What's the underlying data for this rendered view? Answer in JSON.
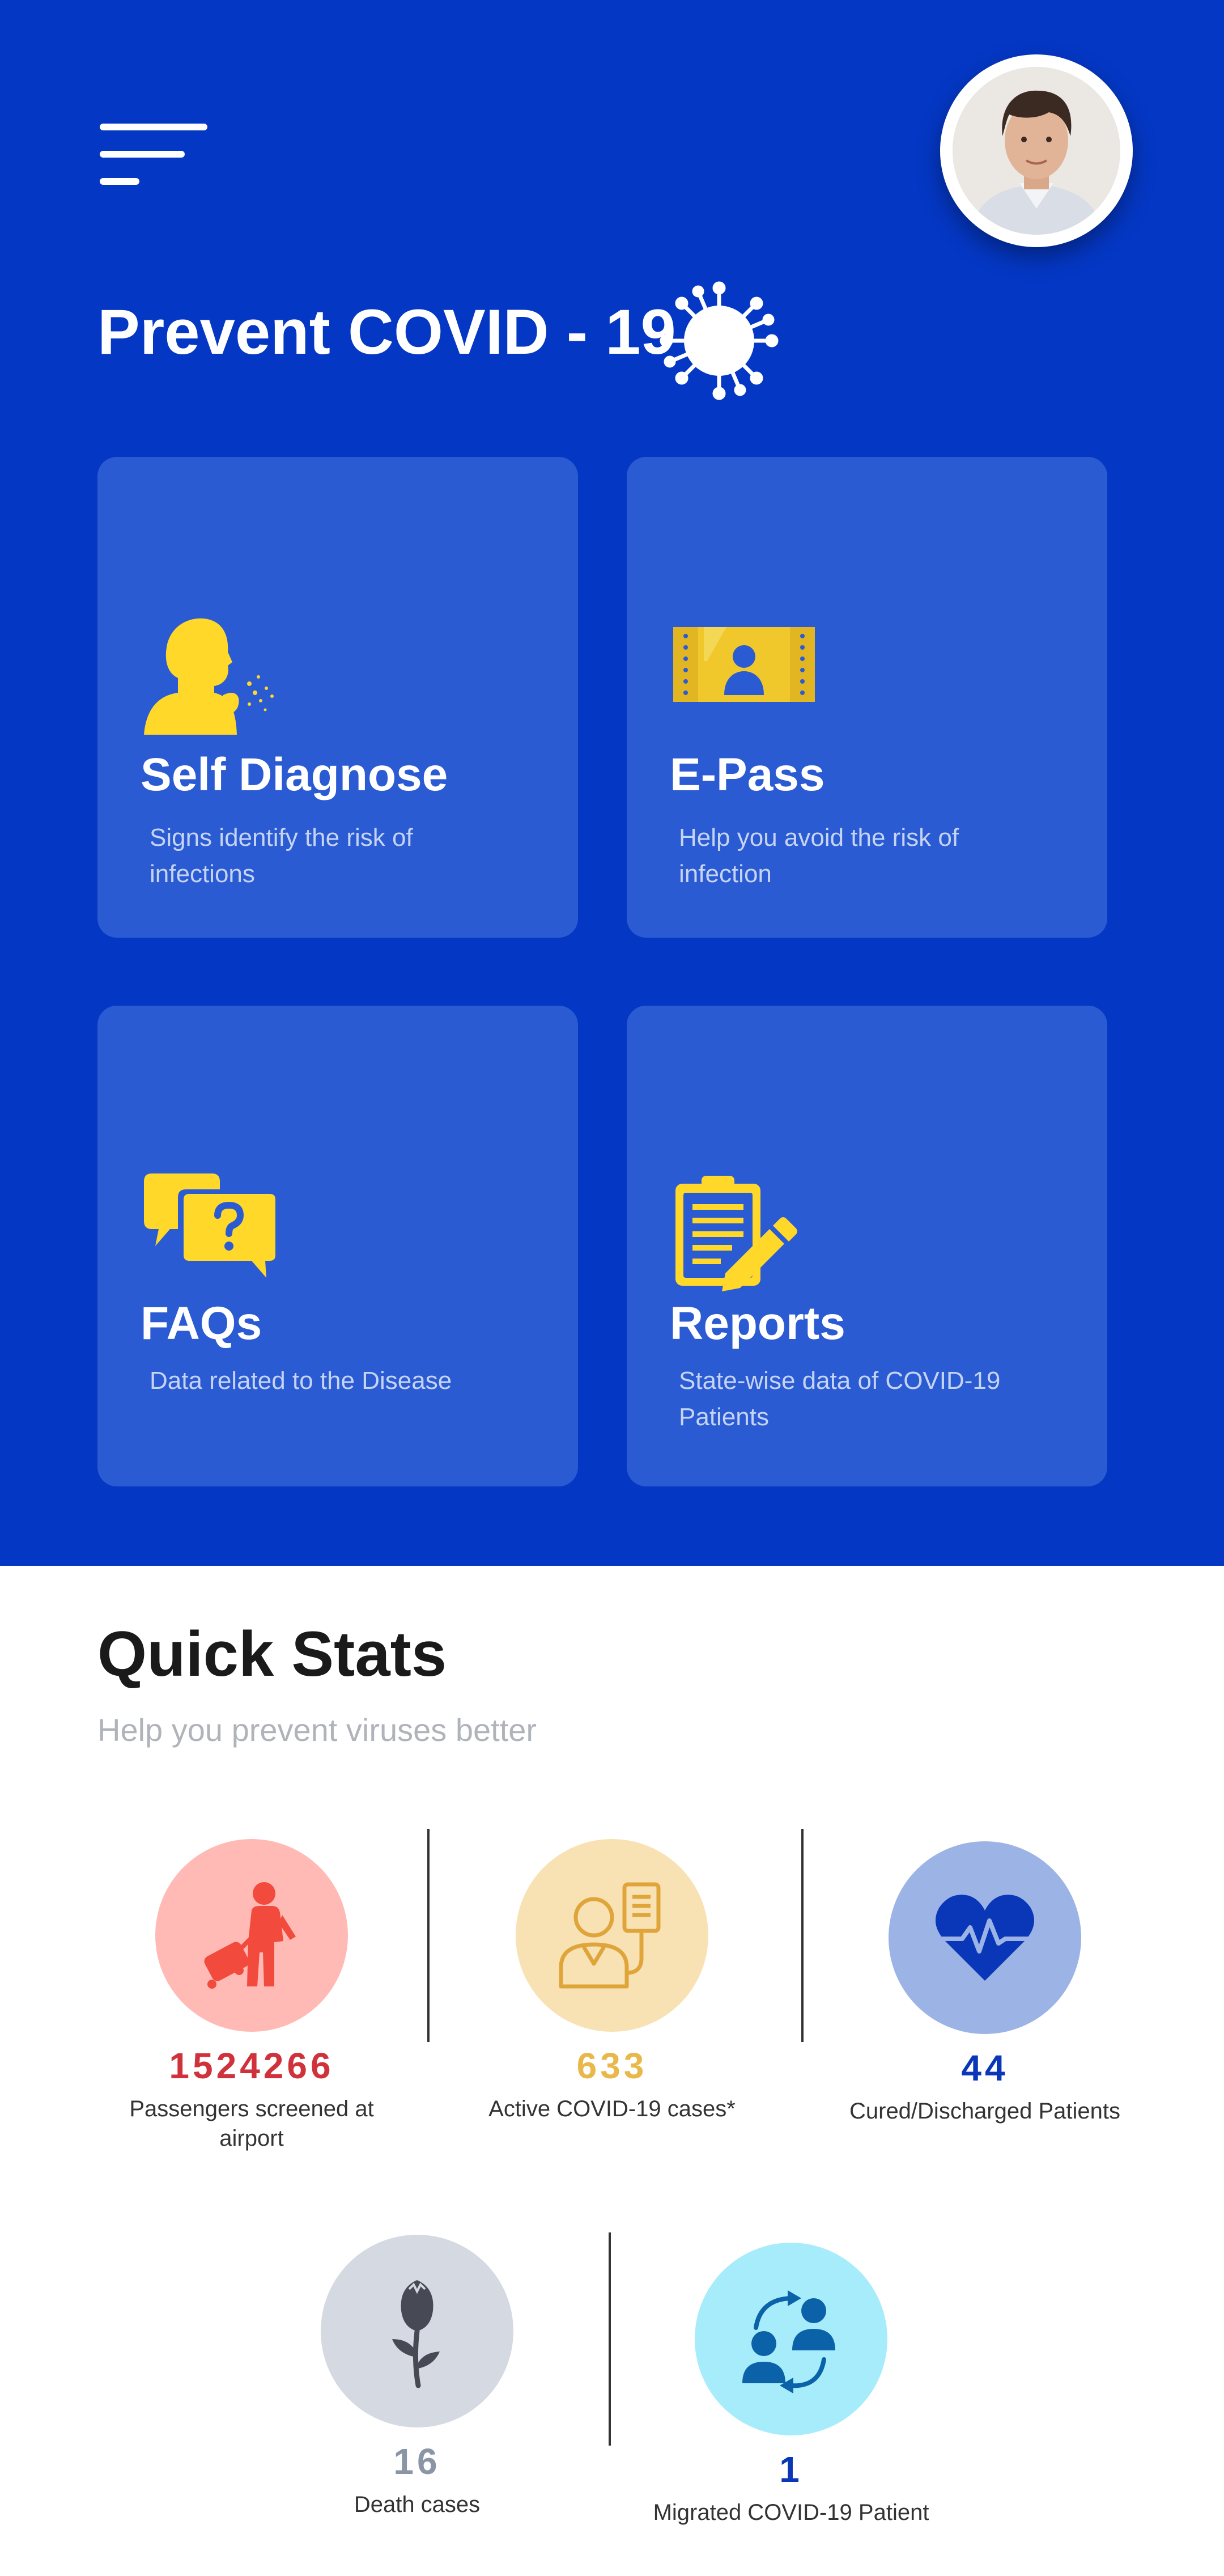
{
  "header": {
    "title": "Prevent COVID - 19",
    "menu_icon": "hamburger-menu-icon",
    "avatar_icon": "user-avatar",
    "virus_icon": "virus-icon"
  },
  "cards": [
    {
      "id": "self-diagnose",
      "title": "Self Diagnose",
      "subtitle": "Signs identify the risk of infections",
      "icon": "coughing-person-icon"
    },
    {
      "id": "e-pass",
      "title": "E-Pass",
      "subtitle": "Help you avoid the risk of infection",
      "icon": "ticket-icon"
    },
    {
      "id": "faqs",
      "title": "FAQs",
      "subtitle": "Data related to the Disease",
      "icon": "question-chat-icon"
    },
    {
      "id": "reports",
      "title": "Reports",
      "subtitle": "State-wise data of COVID-19 Patients",
      "icon": "clipboard-report-icon"
    }
  ],
  "quick_stats": {
    "title": "Quick Stats",
    "subtitle": "Help you prevent viruses better",
    "items": [
      {
        "value": "1524266",
        "label": "Passengers screened at airport",
        "color": "#d0323c",
        "circle": "#ffbab5",
        "icon": "traveler-luggage-icon"
      },
      {
        "value": "633",
        "label": "Active COVID-19 cases*",
        "color": "#e8b84a",
        "circle": "#f8e2b4",
        "icon": "patient-iv-icon"
      },
      {
        "value": "44",
        "label": "Cured/Discharged Patients",
        "color": "#0a37b8",
        "circle": "#9cb3e6",
        "icon": "heart-pulse-icon"
      },
      {
        "value": "16",
        "label": "Death cases",
        "color": "#8a95a6",
        "circle": "#d5d9e1",
        "icon": "rose-icon"
      },
      {
        "value": "1",
        "label": "Migrated COVID-19 Patient",
        "color": "#0a37b8",
        "circle": "#a6ecfb",
        "icon": "people-exchange-icon"
      }
    ]
  }
}
